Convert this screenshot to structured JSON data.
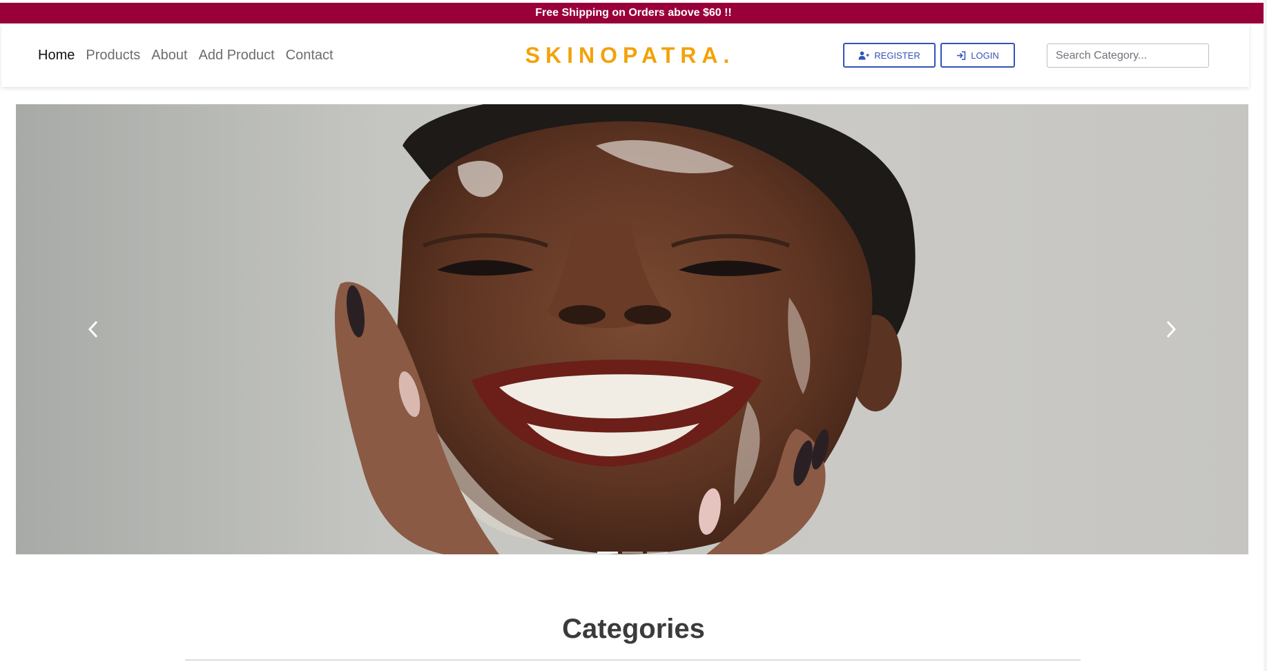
{
  "promo": {
    "text": "Free Shipping on Orders above $60 !!",
    "background": "#99003a"
  },
  "nav": {
    "links": [
      {
        "label": "Home",
        "active": true
      },
      {
        "label": "Products",
        "active": false
      },
      {
        "label": "About",
        "active": false
      },
      {
        "label": "Add Product",
        "active": false
      },
      {
        "label": "Contact",
        "active": false
      }
    ],
    "brand": "SKINOPATRA.",
    "brand_color": "#f2a20c",
    "register_label": "REGISTER",
    "login_label": "LOGIN",
    "button_color": "#3153b8",
    "search_placeholder": "Search Category..."
  },
  "carousel": {
    "slide_description_icon": "hero-slide-image",
    "prev_icon": "chevron-left-icon",
    "next_icon": "chevron-right-icon",
    "indicator_count": 3,
    "active_indicator": 1
  },
  "section": {
    "title": "Categories"
  }
}
